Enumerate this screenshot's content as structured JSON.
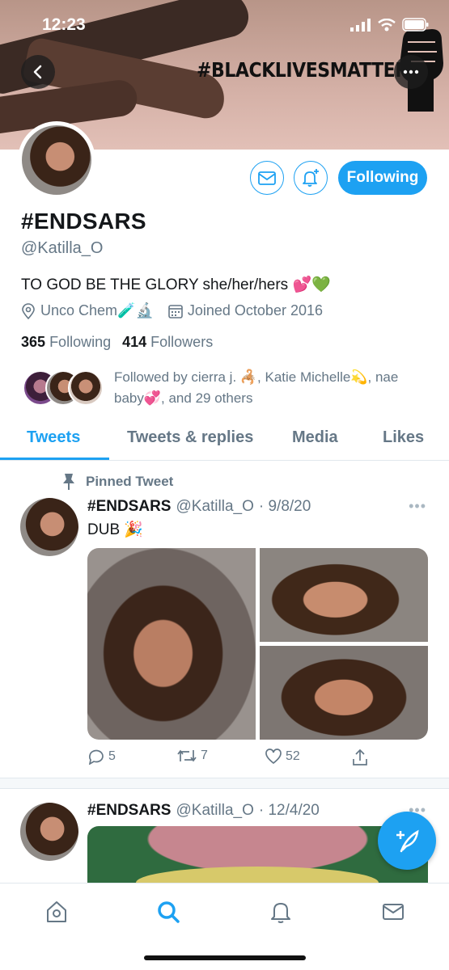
{
  "status_bar": {
    "time": "12:23"
  },
  "banner": {
    "text": "#BLACKLIVESMATTER"
  },
  "profile": {
    "name": "#ENDSARS",
    "handle": "@Katilla_O",
    "bio": "TO GOD BE THE GLORY she/her/hers 💕💚",
    "location": "Unco Chem🧪🔬",
    "joined": "Joined October 2016",
    "following_count": "365",
    "following_label": "Following",
    "followers_count": "414",
    "followers_label": "Followers",
    "followed_by": "Followed by cierra j. 🦂, Katie Michelle💫, nae baby💞, and 29 others",
    "follow_button": "Following"
  },
  "tabs": [
    "Tweets",
    "Tweets & replies",
    "Media",
    "Likes"
  ],
  "tweets": [
    {
      "pinned_label": "Pinned Tweet",
      "name": "#ENDSARS",
      "handle": "@Katilla_O",
      "date": "· 9/8/20",
      "text": "DUB 🎉",
      "replies": "5",
      "retweets": "7",
      "likes": "52"
    },
    {
      "name": "#ENDSARS",
      "handle": "@Katilla_O",
      "date": "· 12/4/20"
    }
  ],
  "colors": {
    "accent": "#1da1f2",
    "muted": "#657786",
    "text": "#14171a"
  }
}
